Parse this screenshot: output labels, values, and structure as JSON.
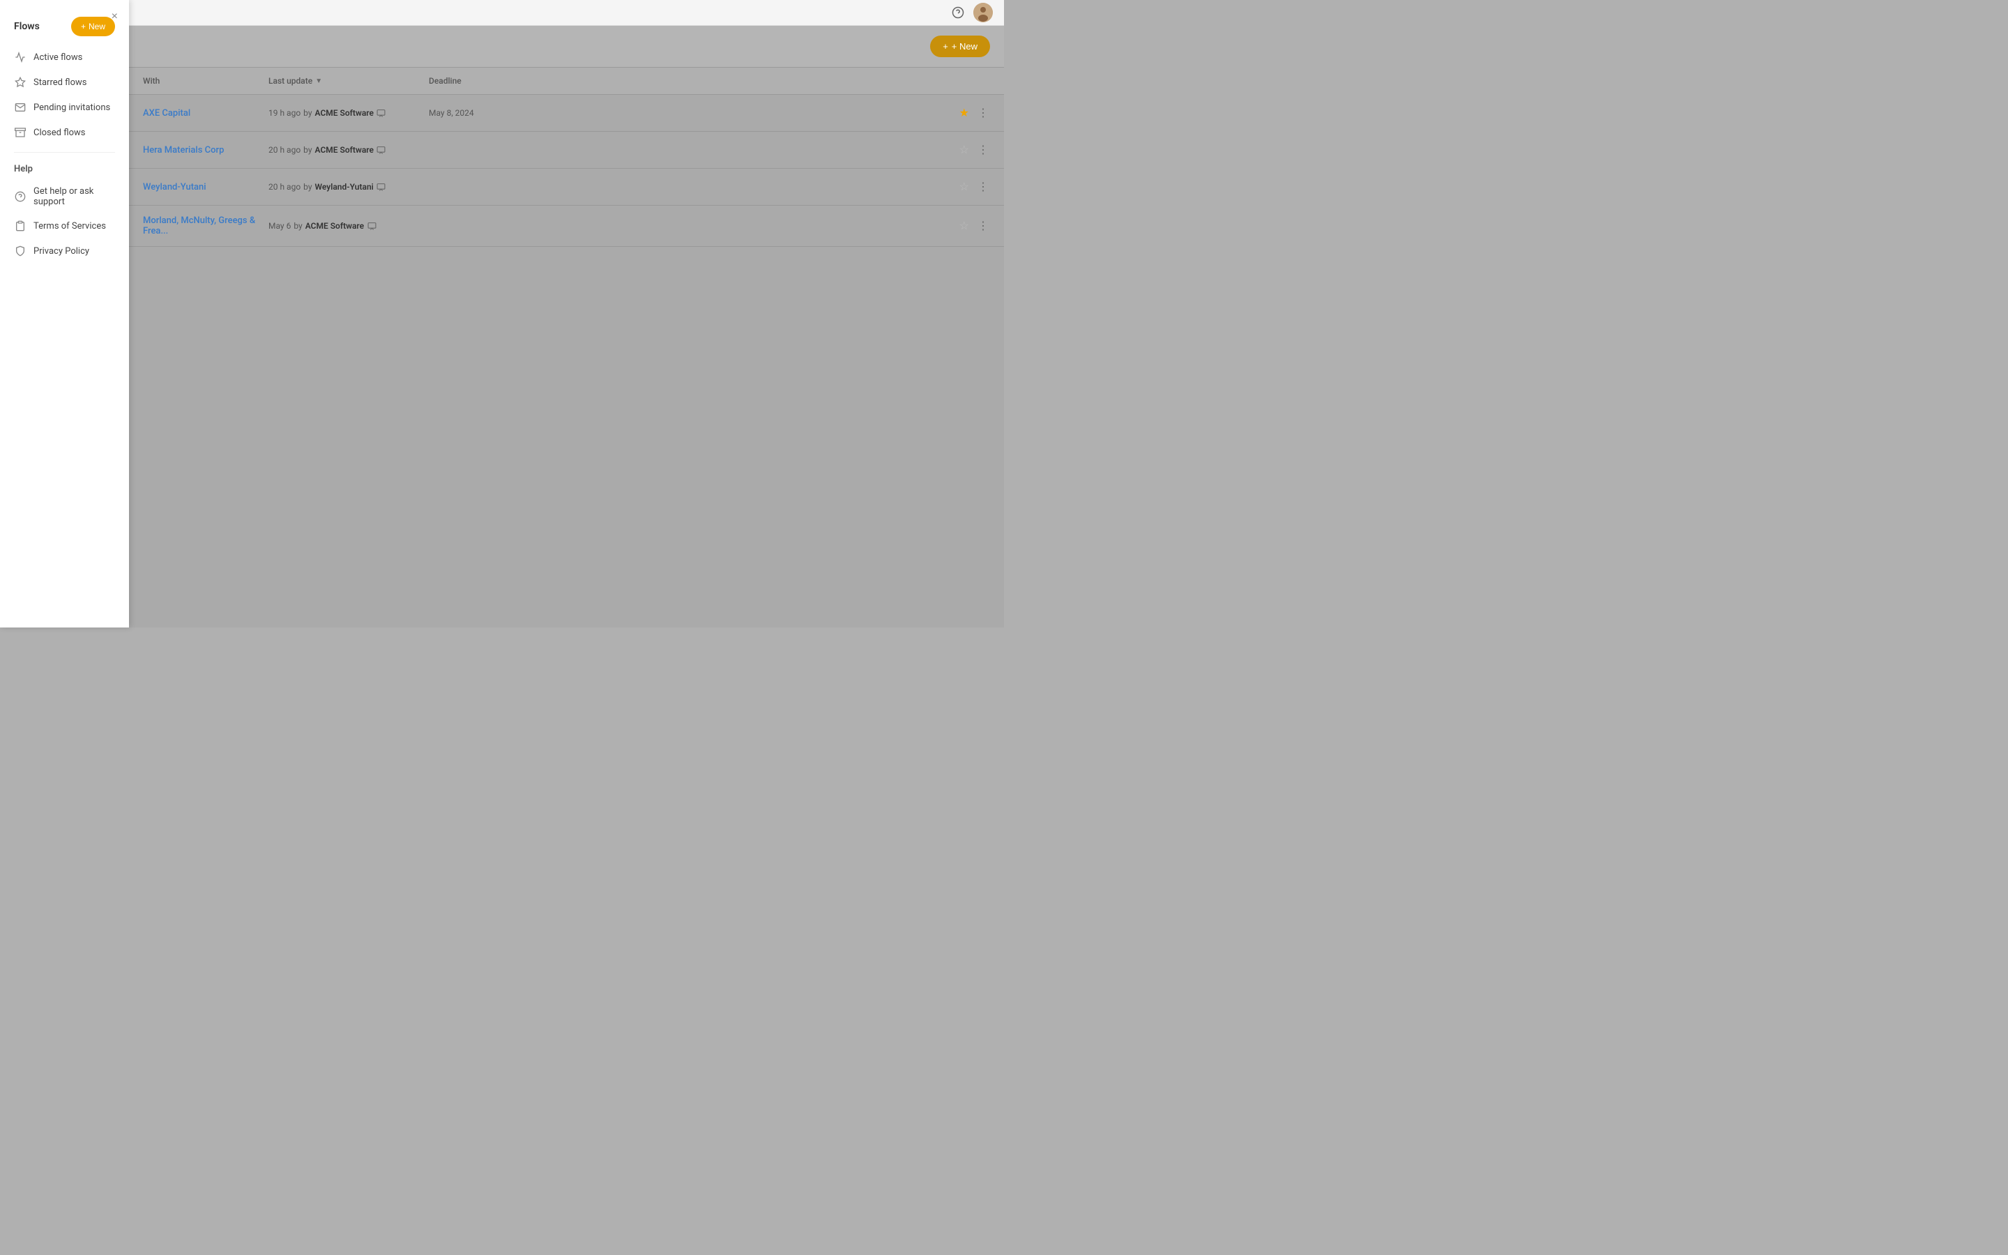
{
  "topbar": {
    "help_icon": "?",
    "avatar_alt": "user avatar"
  },
  "sidebar": {
    "close_label": "×",
    "flows_title": "Flows",
    "new_button_label": "+ New",
    "nav_items": [
      {
        "id": "active-flows",
        "icon": "activity",
        "label": "Active flows"
      },
      {
        "id": "starred-flows",
        "icon": "star",
        "label": "Starred flows"
      },
      {
        "id": "pending-invitations",
        "icon": "mail",
        "label": "Pending invitations"
      },
      {
        "id": "closed-flows",
        "icon": "archive",
        "label": "Closed flows"
      }
    ],
    "help_title": "Help",
    "help_items": [
      {
        "id": "get-help",
        "icon": "question-circle",
        "label": "Get help or ask support"
      },
      {
        "id": "terms",
        "icon": "clipboard",
        "label": "Terms of Services"
      },
      {
        "id": "privacy",
        "icon": "shield",
        "label": "Privacy Policy"
      }
    ]
  },
  "main": {
    "new_button_label": "+ New",
    "table": {
      "columns": [
        {
          "id": "with",
          "label": "With"
        },
        {
          "id": "last_update",
          "label": "Last update",
          "sortable": true
        },
        {
          "id": "deadline",
          "label": "Deadline"
        }
      ],
      "rows": [
        {
          "id": "row-1",
          "company": "AXE Capital",
          "update_time": "19 h ago",
          "update_by": "ACME Software",
          "deadline": "May 8, 2024",
          "starred": true
        },
        {
          "id": "row-2",
          "company": "Hera Materials Corp",
          "update_time": "20 h ago",
          "update_by": "ACME Software",
          "deadline": "",
          "starred": false
        },
        {
          "id": "row-3",
          "company": "Weyland-Yutani",
          "update_time": "20 h ago",
          "update_by": "Weyland-Yutani",
          "deadline": "",
          "starred": false
        },
        {
          "id": "row-4",
          "company": "Morland, McNulty, Greegs & Frea...",
          "update_time": "May 6",
          "update_by": "ACME Software",
          "deadline": "",
          "starred": false
        }
      ]
    }
  },
  "colors": {
    "accent": "#f0a500",
    "link": "#3a7bc8",
    "sidebar_bg": "#ffffff",
    "overlay_bg": "#aaaaaa"
  }
}
